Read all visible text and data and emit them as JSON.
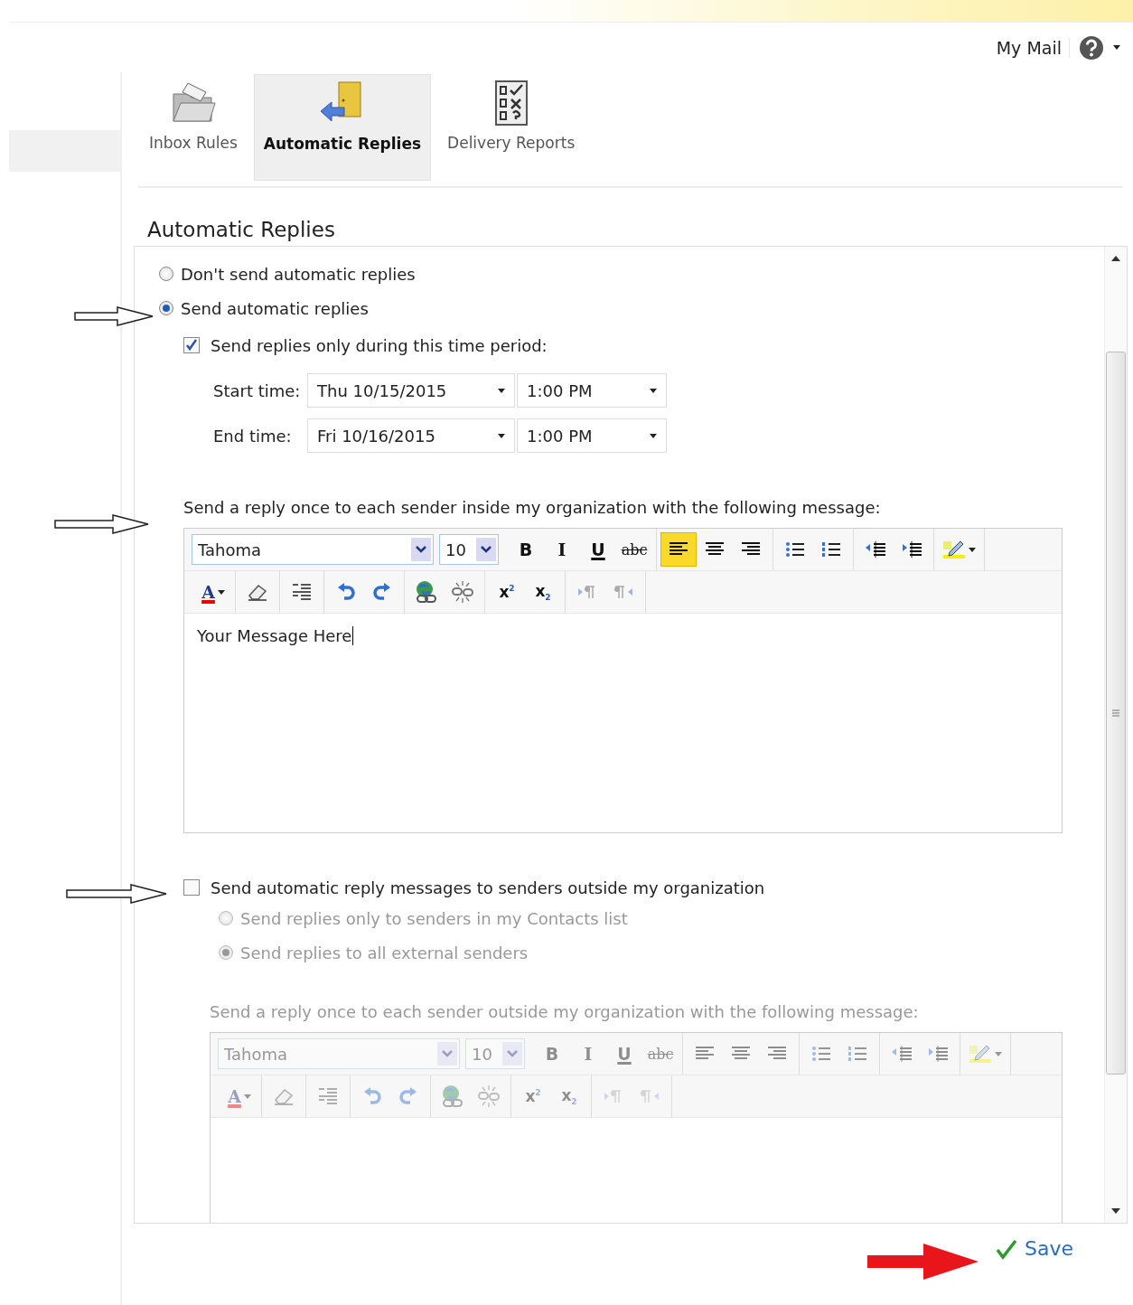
{
  "header": {
    "link": "My Mail"
  },
  "tabs": [
    {
      "label": "Inbox Rules",
      "selected": false,
      "kind": "folder"
    },
    {
      "label": "Automatic Replies",
      "selected": true,
      "kind": "door"
    },
    {
      "label": "Delivery Reports",
      "selected": false,
      "kind": "checklist"
    }
  ],
  "heading": "Automatic Replies",
  "reply_mode": [
    {
      "label": "Don't send automatic replies",
      "selected": false
    },
    {
      "label": "Send automatic replies",
      "selected": true
    }
  ],
  "time_period": {
    "label": "Send replies only during this time period:",
    "checked": true,
    "rows": [
      {
        "label": "Start time:",
        "date": "Thu 10/15/2015",
        "time": "1:00 PM"
      },
      {
        "label": "End time:",
        "date": "Fri 10/16/2015",
        "time": "1:00 PM"
      }
    ]
  },
  "internal": {
    "label": "Send a reply once to each sender inside my organization with the following message:",
    "editor": {
      "font": "Tahoma",
      "size": "10",
      "body": "Your Message Here",
      "rows": [
        [
          [
            {
              "kind": "bold",
              "label": "B"
            },
            {
              "kind": "italic",
              "label": "I"
            },
            {
              "kind": "underline",
              "label": "U"
            },
            {
              "kind": "strike",
              "label": "abc"
            }
          ],
          [
            {
              "kind": "align-left",
              "selected": true
            },
            {
              "kind": "align-center",
              "selected": false
            },
            {
              "kind": "align-right",
              "selected": false
            }
          ],
          [
            {
              "kind": "bullets"
            },
            {
              "kind": "numbering"
            }
          ],
          [
            {
              "kind": "outdent"
            },
            {
              "kind": "indent"
            }
          ],
          [
            {
              "kind": "highlight"
            }
          ]
        ],
        [
          [
            {
              "kind": "font-color",
              "label": "A"
            }
          ],
          [
            {
              "kind": "eraser"
            }
          ],
          [
            {
              "kind": "line-spacing"
            }
          ],
          [
            {
              "kind": "undo"
            },
            {
              "kind": "redo"
            }
          ],
          [
            {
              "kind": "link"
            },
            {
              "kind": "unlink"
            }
          ],
          [
            {
              "kind": "superscript",
              "label": "x$^{2}$"
            },
            {
              "kind": "subscript",
              "label": "x$_{2}$"
            }
          ],
          [
            {
              "kind": "ltr"
            },
            {
              "kind": "rtl"
            }
          ]
        ]
      ]
    }
  },
  "external": {
    "label": "Send automatic reply messages to senders outside my organization",
    "checked": false,
    "disabled": true,
    "audience": [
      {
        "label": "Send replies only to senders in my Contacts list",
        "selected": false
      },
      {
        "label": "Send replies to all external senders",
        "selected": true
      }
    ],
    "message_label": "Send a reply once to each sender outside my organization with the following message:",
    "editor": {
      "font": "Tahoma",
      "size": "10",
      "rows": [
        [
          [
            {
              "kind": "bold",
              "label": "B"
            },
            {
              "kind": "italic",
              "label": "I"
            },
            {
              "kind": "underline",
              "label": "U"
            },
            {
              "kind": "strike",
              "label": "abc"
            }
          ],
          [
            {
              "kind": "align-left",
              "selected": false
            },
            {
              "kind": "align-center",
              "selected": false
            },
            {
              "kind": "align-right",
              "selected": false
            }
          ],
          [
            {
              "kind": "bullets"
            },
            {
              "kind": "numbering"
            }
          ],
          [
            {
              "kind": "outdent"
            },
            {
              "kind": "indent"
            }
          ],
          [
            {
              "kind": "highlight"
            }
          ]
        ],
        [
          [
            {
              "kind": "font-color",
              "label": "A"
            }
          ],
          [
            {
              "kind": "eraser"
            }
          ],
          [
            {
              "kind": "line-spacing"
            }
          ],
          [
            {
              "kind": "undo"
            },
            {
              "kind": "redo"
            }
          ],
          [
            {
              "kind": "link"
            },
            {
              "kind": "unlink"
            }
          ],
          [
            {
              "kind": "superscript",
              "label": "x$^{2}$"
            },
            {
              "kind": "subscript",
              "label": "x$_{2}$"
            }
          ],
          [
            {
              "kind": "ltr"
            },
            {
              "kind": "rtl"
            }
          ]
        ]
      ]
    }
  },
  "save": "Save"
}
